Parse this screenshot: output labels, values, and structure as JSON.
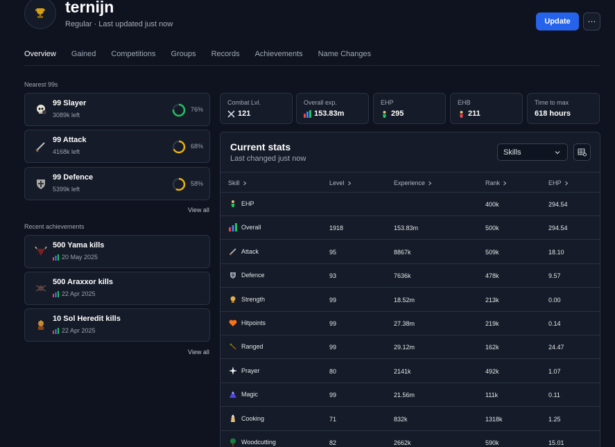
{
  "player": {
    "name": "ternijn",
    "subtitle": "Regular · Last updated just now",
    "avatar_icon": "trophy-icon"
  },
  "header": {
    "update_label": "Update",
    "more_label": "⋯"
  },
  "tabs": [
    {
      "label": "Overview",
      "active": true
    },
    {
      "label": "Gained"
    },
    {
      "label": "Competitions"
    },
    {
      "label": "Groups"
    },
    {
      "label": "Records"
    },
    {
      "label": "Achievements"
    },
    {
      "label": "Name Changes"
    }
  ],
  "nearest": {
    "title": "Nearest 99s",
    "view_all": "View all",
    "items": [
      {
        "title": "99 Slayer",
        "sub": "3089k left",
        "pct": "76%",
        "progress": 0.76,
        "color": "#22c55e",
        "icon": "slayer-skull-icon"
      },
      {
        "title": "99 Attack",
        "sub": "4168k left",
        "pct": "68%",
        "progress": 0.68,
        "color": "#eab308",
        "icon": "attack-sword-icon"
      },
      {
        "title": "99 Defence",
        "sub": "5399k left",
        "pct": "58%",
        "progress": 0.58,
        "color": "#eab308",
        "icon": "defence-shield-icon"
      }
    ]
  },
  "recent": {
    "title": "Recent achievements",
    "view_all": "View all",
    "items": [
      {
        "title": "500 Yama kills",
        "date": "20 May 2025",
        "icon": "yama-icon"
      },
      {
        "title": "500 Araxxor kills",
        "date": "22 Apr 2025",
        "icon": "araxxor-icon"
      },
      {
        "title": "10 Sol Heredit kills",
        "date": "22 Apr 2025",
        "icon": "sol-heredit-icon"
      }
    ]
  },
  "stats": [
    {
      "label": "Combat Lvl.",
      "value": "121",
      "icon": "combat-swords-icon"
    },
    {
      "label": "Overall exp.",
      "value": "153.83m",
      "icon": "overall-bars-icon"
    },
    {
      "label": "EHP",
      "value": "295",
      "icon": "ehp-icon"
    },
    {
      "label": "EHB",
      "value": "211",
      "icon": "ehb-icon"
    },
    {
      "label": "Time to max",
      "value": "618 hours",
      "icon": ""
    }
  ],
  "current": {
    "title": "Current stats",
    "subtitle": "Last changed just now",
    "select_value": "Skills",
    "columns": [
      "Skill",
      "Level",
      "Experience",
      "Rank",
      "EHP"
    ],
    "rows": [
      {
        "skill": "EHP",
        "level": "",
        "exp": "",
        "rank": "400k",
        "ehp": "294.54",
        "icon": "ehp-icon"
      },
      {
        "skill": "Overall",
        "level": "1918",
        "exp": "153.83m",
        "rank": "500k",
        "ehp": "294.54",
        "icon": "overall-icon"
      },
      {
        "skill": "Attack",
        "level": "95",
        "exp": "8867k",
        "rank": "509k",
        "ehp": "18.10",
        "icon": "attack-icon"
      },
      {
        "skill": "Defence",
        "level": "93",
        "exp": "7636k",
        "rank": "478k",
        "ehp": "9.57",
        "icon": "defence-icon"
      },
      {
        "skill": "Strength",
        "level": "99",
        "exp": "18.52m",
        "rank": "213k",
        "ehp": "0.00",
        "icon": "strength-icon"
      },
      {
        "skill": "Hitpoints",
        "level": "99",
        "exp": "27.38m",
        "rank": "219k",
        "ehp": "0.14",
        "icon": "hitpoints-icon"
      },
      {
        "skill": "Ranged",
        "level": "99",
        "exp": "29.12m",
        "rank": "162k",
        "ehp": "24.47",
        "icon": "ranged-icon"
      },
      {
        "skill": "Prayer",
        "level": "80",
        "exp": "2141k",
        "rank": "492k",
        "ehp": "1.07",
        "icon": "prayer-icon"
      },
      {
        "skill": "Magic",
        "level": "99",
        "exp": "21.56m",
        "rank": "111k",
        "ehp": "0.11",
        "icon": "magic-icon"
      },
      {
        "skill": "Cooking",
        "level": "71",
        "exp": "832k",
        "rank": "1318k",
        "ehp": "1.25",
        "icon": "cooking-icon"
      },
      {
        "skill": "Woodcutting",
        "level": "82",
        "exp": "2662k",
        "rank": "590k",
        "ehp": "15.01",
        "icon": "woodcutting-icon"
      }
    ]
  }
}
